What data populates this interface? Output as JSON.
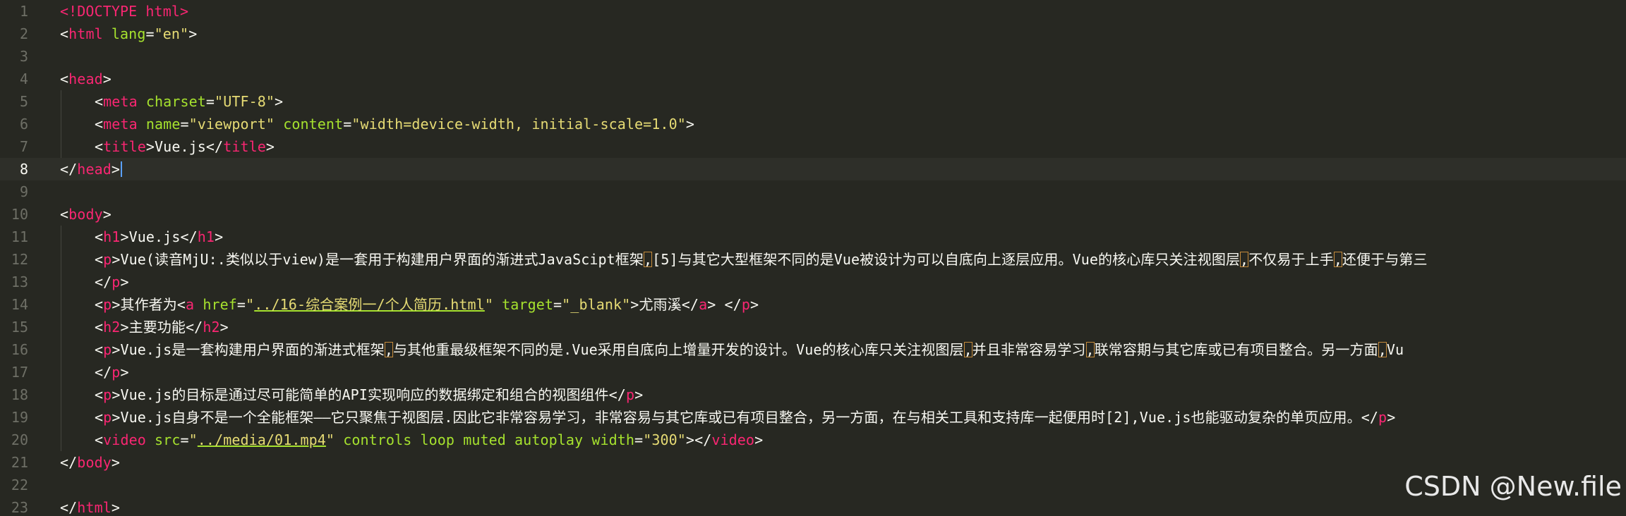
{
  "gutter": {
    "line_numbers": [
      "1",
      "2",
      "3",
      "4",
      "5",
      "6",
      "7",
      "8",
      "9",
      "10",
      "11",
      "12",
      "13",
      "14",
      "15",
      "16",
      "17",
      "18",
      "19",
      "20",
      "21",
      "22",
      "23"
    ],
    "current_line": "8"
  },
  "code": {
    "l1_doctype": "<!DOCTYPE html>",
    "l2_tag": "html",
    "l2_attr": "lang",
    "l2_val": "\"en\"",
    "l4_tag": "head",
    "l5_tag": "meta",
    "l5_attr": "charset",
    "l5_val": "\"UTF-8\"",
    "l6_tag": "meta",
    "l6_attr1": "name",
    "l6_val1": "\"viewport\"",
    "l6_attr2": "content",
    "l6_val2": "\"width=device-width, initial-scale=1.0\"",
    "l7_tag": "title",
    "l7_text": "Vue.js",
    "l8_tag": "head",
    "l10_tag": "body",
    "l11_tag": "h1",
    "l11_text": "Vue.js",
    "l12_tag": "p",
    "l12_text1": "Vue(读音MjU:.类似以于view)是一套用于构建用户界面的渐进式JavaScipt框架",
    "l12_comma1": ",",
    "l12_text2": "[5]与其它大型框架不同的是Vue被设计为可以自底向上逐层应用。Vue的核心库只关注视图层",
    "l12_comma2": ",",
    "l12_text3": "不仅易于上手",
    "l12_comma3": ",",
    "l12_text4": "还便于与第三",
    "l13_tag": "p",
    "l14_tag": "p",
    "l14_text": "其作者为",
    "l14_a": "a",
    "l14_attr1": "href",
    "l14_href": "../16-综合案例一/个人简历.html",
    "l14_attr2": "target",
    "l14_target": "\"_blank\"",
    "l14_link_text": "尤雨溪",
    "l15_tag": "h2",
    "l15_text": "主要功能",
    "l16_tag": "p",
    "l16_text1": "Vue.js是一套构建用户界面的渐进式框架",
    "l16_comma1": ",",
    "l16_text2": "与其他重最级框架不同的是.Vue采用自底向上增量开发的设计。Vue的核心库只关注视图层",
    "l16_comma2": ",",
    "l16_text3": "并且非常容易学习",
    "l16_comma3": ",",
    "l16_text4": "联常容期与其它库或已有项目整合。另一方面",
    "l16_comma4": ",",
    "l16_text5": "Vu",
    "l17_tag": "p",
    "l18_tag": "p",
    "l18_text": "Vue.js的目标是通过尽可能简单的API实现响应的数据绑定和组合的视图组件",
    "l19_tag": "p",
    "l19_text": "Vue.js自身不是一个全能框架——它只聚焦于视图层.因此它非常容易学习，非常容易与其它库或已有项目整合，另一方面，在与相关工具和支持库一起便用时[2],Vue.js也能驱动复杂的单页应用。",
    "l20_tag": "video",
    "l20_attr1": "src",
    "l20_src": "../media/01.mp4",
    "l20_attrs": "controls loop muted autoplay",
    "l20_attr2": "width",
    "l20_width": "\"300\"",
    "l21_tag": "body",
    "l23_tag": "html"
  },
  "watermark": "CSDN @New.file"
}
